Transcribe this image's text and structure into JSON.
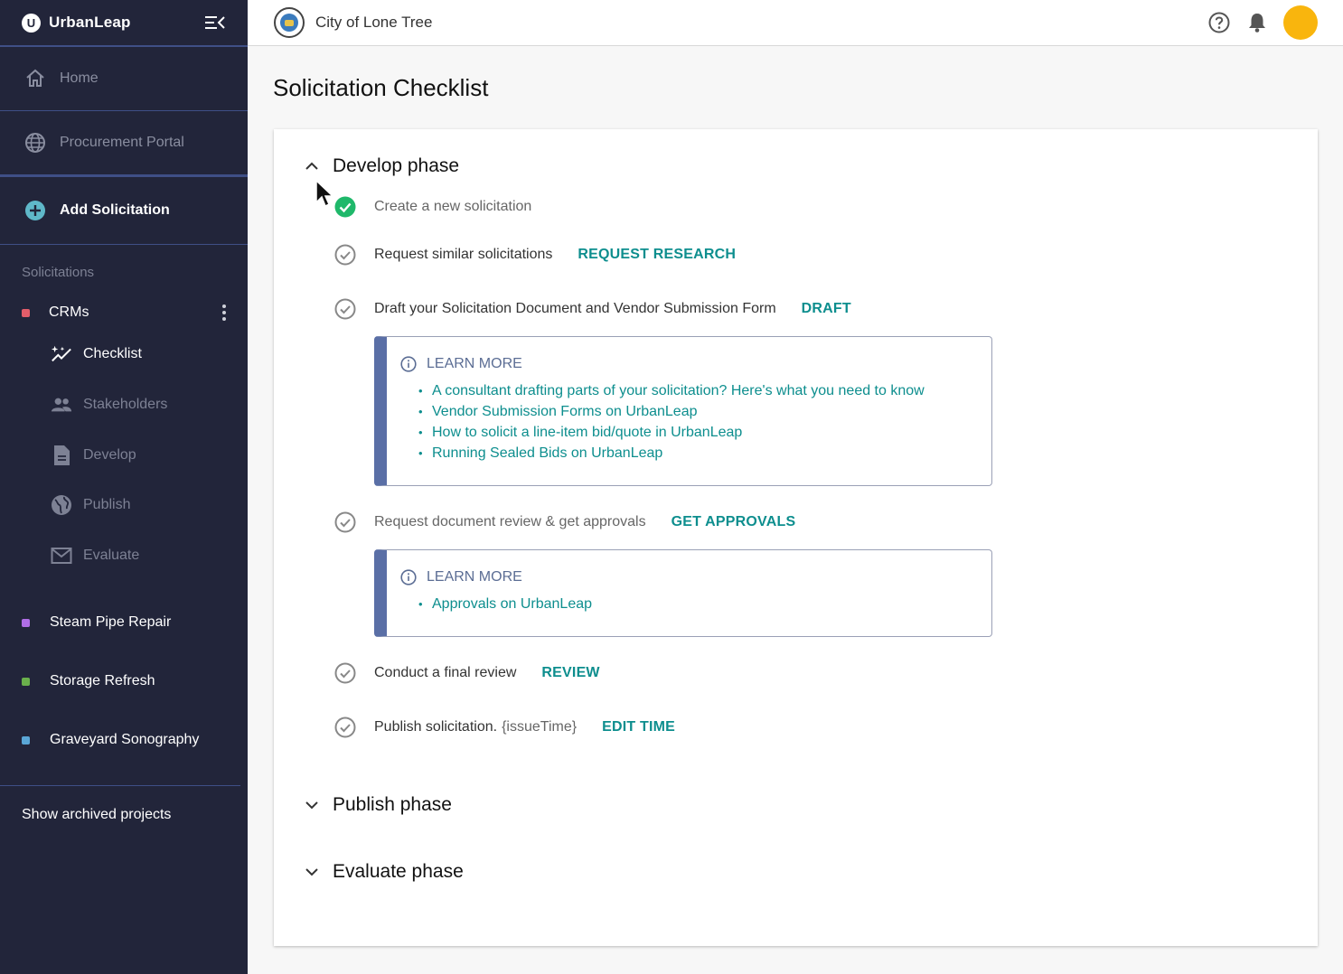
{
  "sidebar": {
    "brand": "UrbanLeap",
    "nav": {
      "home": "Home",
      "portal": "Procurement Portal",
      "add": "Add Solicitation"
    },
    "section_label": "Solicitations",
    "projects": [
      {
        "name": "CRMs",
        "color": "#e35d6a"
      },
      {
        "name": "Steam Pipe Repair",
        "color": "#b06ee6"
      },
      {
        "name": "Storage Refresh",
        "color": "#6ab04c"
      },
      {
        "name": "Graveyard Sonography",
        "color": "#5aa6d6"
      }
    ],
    "subnav": {
      "checklist": "Checklist",
      "stakeholders": "Stakeholders",
      "develop": "Develop",
      "publish": "Publish",
      "evaluate": "Evaluate"
    },
    "archived": "Show archived projects"
  },
  "topbar": {
    "org": "City of Lone Tree"
  },
  "main": {
    "title": "Solicitation Checklist",
    "phases": {
      "develop": "Develop phase",
      "publish": "Publish phase",
      "evaluate": "Evaluate phase"
    },
    "tasks": [
      {
        "label": "Create a new solicitation",
        "action": "",
        "done": true
      },
      {
        "label": "Request similar solicitations",
        "action": "REQUEST RESEARCH",
        "done": false
      },
      {
        "label": "Draft your Solicitation Document and Vendor Submission Form",
        "action": "DRAFT",
        "done": false
      },
      {
        "label": "Request document review & get approvals",
        "action": "GET APPROVALS",
        "done": false
      },
      {
        "label": "Conduct a final review",
        "action": "REVIEW",
        "done": false
      },
      {
        "label": "Publish solicitation.",
        "suffix": "{issueTime}",
        "action": "EDIT TIME",
        "done": false
      }
    ],
    "learn_more_1": {
      "title": "LEARN MORE",
      "links": [
        "A consultant drafting parts of your solicitation? Here's what you need to know",
        "Vendor Submission Forms on UrbanLeap",
        "How to solicit a line-item bid/quote in UrbanLeap",
        "Running Sealed Bids on UrbanLeap"
      ]
    },
    "learn_more_2": {
      "title": "LEARN MORE",
      "links": [
        "Approvals on UrbanLeap"
      ]
    }
  },
  "colors": {
    "sidebar_bg": "#22253a",
    "accent_teal": "#0d8e8e",
    "success_green": "#1fb86a",
    "avatar": "#f9b50d",
    "learn_more_bar": "#5a6fa6"
  }
}
